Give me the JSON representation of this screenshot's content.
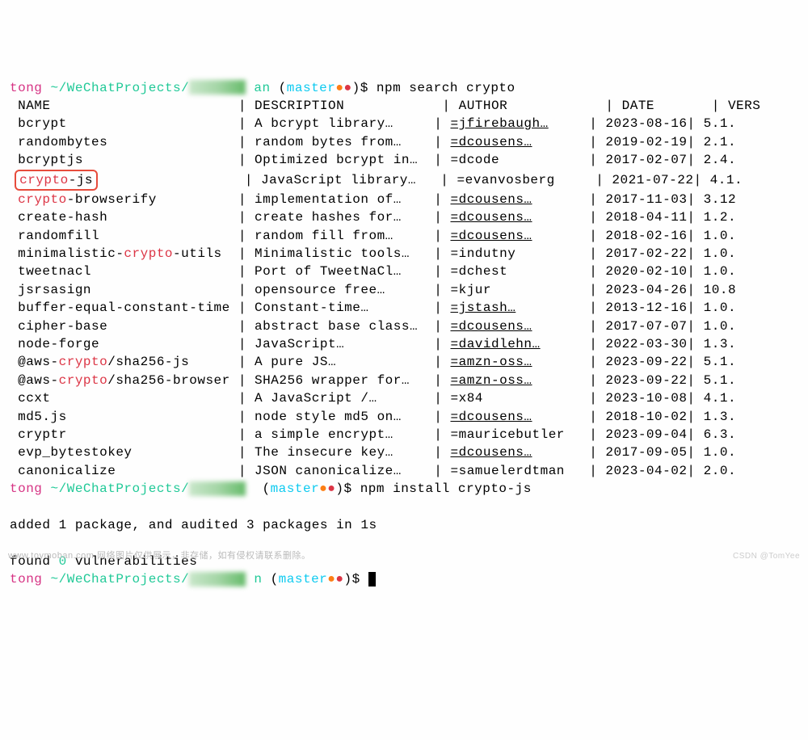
{
  "prompt1": {
    "user": "tong",
    "path": "~/WeChatProjects/",
    "suffix": "an",
    "branch": "master",
    "command": "npm search crypto"
  },
  "headers": {
    "name": "NAME",
    "description": "DESCRIPTION",
    "author": "AUTHOR",
    "date": "DATE",
    "version": "VERS"
  },
  "rows": [
    {
      "name": "bcrypt",
      "nameHl": [],
      "desc": "A bcrypt library…",
      "author": "=jfirebaugh…",
      "authorUnderline": true,
      "date": "2023-08-16",
      "ver": "5.1."
    },
    {
      "name": "randombytes",
      "nameHl": [],
      "desc": "random bytes from…",
      "author": "=dcousens…",
      "authorUnderline": true,
      "date": "2019-02-19",
      "ver": "2.1."
    },
    {
      "name": "bcryptjs",
      "nameHl": [],
      "desc": "Optimized bcrypt in…",
      "author": "=dcode",
      "authorUnderline": false,
      "date": "2017-02-07",
      "ver": "2.4."
    },
    {
      "name": "crypto-js",
      "nameHl": [
        "crypto"
      ],
      "boxed": true,
      "desc": "JavaScript library…",
      "author": "=evanvosberg",
      "authorUnderline": false,
      "date": "2021-07-22",
      "ver": "4.1."
    },
    {
      "name": "crypto-browserify",
      "nameHl": [
        "crypto"
      ],
      "desc": "implementation of…",
      "author": "=dcousens…",
      "authorUnderline": true,
      "date": "2017-11-03",
      "ver": "3.12"
    },
    {
      "name": "create-hash",
      "nameHl": [],
      "desc": "create hashes for…",
      "author": "=dcousens…",
      "authorUnderline": true,
      "date": "2018-04-11",
      "ver": "1.2."
    },
    {
      "name": "randomfill",
      "nameHl": [],
      "desc": "random fill from…",
      "author": "=dcousens…",
      "authorUnderline": true,
      "date": "2018-02-16",
      "ver": "1.0."
    },
    {
      "name": "minimalistic-crypto-utils",
      "nameHl": [
        "crypto"
      ],
      "desc": "Minimalistic tools…",
      "author": "=indutny",
      "authorUnderline": false,
      "date": "2017-02-22",
      "ver": "1.0."
    },
    {
      "name": "tweetnacl",
      "nameHl": [],
      "desc": "Port of TweetNaCl…",
      "author": "=dchest",
      "authorUnderline": false,
      "date": "2020-02-10",
      "ver": "1.0."
    },
    {
      "name": "jsrsasign",
      "nameHl": [],
      "desc": "opensource free…",
      "author": "=kjur",
      "authorUnderline": false,
      "date": "2023-04-26",
      "ver": "10.8"
    },
    {
      "name": "buffer-equal-constant-time",
      "nameHl": [],
      "wrap": true,
      "desc": "Constant-time…",
      "author": "=jstash…",
      "authorUnderline": true,
      "date": "2013-12-16",
      "ver": "1.0."
    },
    {
      "name": "cipher-base",
      "nameHl": [],
      "desc": "abstract base class…",
      "author": "=dcousens…",
      "authorUnderline": true,
      "date": "2017-07-07",
      "ver": "1.0."
    },
    {
      "name": "node-forge",
      "nameHl": [],
      "desc": "JavaScript…",
      "author": "=davidlehn…",
      "authorUnderline": true,
      "date": "2022-03-30",
      "ver": "1.3."
    },
    {
      "name": "@aws-crypto/sha256-js",
      "nameHl": [
        "crypto"
      ],
      "desc": "A pure JS…",
      "author": "=amzn-oss…",
      "authorUnderline": true,
      "date": "2023-09-22",
      "ver": "5.1."
    },
    {
      "name": "@aws-crypto/sha256-browser",
      "nameHl": [
        "crypto"
      ],
      "wrap": true,
      "desc": "SHA256 wrapper for…",
      "author": "=amzn-oss…",
      "authorUnderline": true,
      "date": "2023-09-22",
      "ver": "5.1."
    },
    {
      "name": "ccxt",
      "nameHl": [],
      "desc": "A JavaScript /…",
      "author": "=x84",
      "authorUnderline": false,
      "date": "2023-10-08",
      "ver": "4.1."
    },
    {
      "name": "md5.js",
      "nameHl": [],
      "desc": "node style md5 on…",
      "author": "=dcousens…",
      "authorUnderline": true,
      "date": "2018-10-02",
      "ver": "1.3."
    },
    {
      "name": "cryptr",
      "nameHl": [],
      "desc": "a simple encrypt…",
      "author": "=mauricebutler",
      "authorUnderline": false,
      "date": "2023-09-04",
      "ver": "6.3."
    },
    {
      "name": "evp_bytestokey",
      "nameHl": [],
      "desc": "The insecure key…",
      "author": "=dcousens…",
      "authorUnderline": true,
      "date": "2017-09-05",
      "ver": "1.0."
    },
    {
      "name": "canonicalize",
      "nameHl": [],
      "desc": "JSON canonicalize…",
      "author": "=samuelerdtman",
      "authorUnderline": false,
      "date": "2023-04-02",
      "ver": "2.0."
    }
  ],
  "prompt2": {
    "user": "tong",
    "path": "~/WeChatProjects/",
    "branch": "master",
    "command": "npm install crypto-js"
  },
  "install": {
    "addedLine": "added 1 package, and audited 3 packages in 1s",
    "foundPre": "found ",
    "zero": "0",
    "foundPost": " vulnerabilities"
  },
  "prompt3": {
    "user": "tong",
    "path": "~/WeChatProjects/",
    "suffix": "n",
    "branch": "master"
  },
  "watermark": "www.toymoban.com 网络图片仅供展示，非存储，如有侵权请联系删除。",
  "watermarkRight": "CSDN @TomYee"
}
